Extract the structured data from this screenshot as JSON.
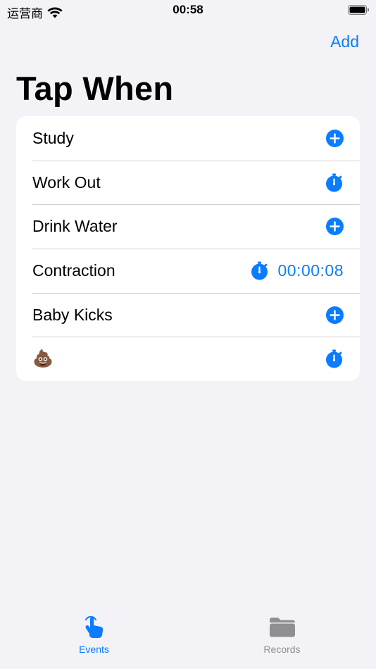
{
  "status_bar": {
    "carrier": "运营商",
    "time": "00:58"
  },
  "nav": {
    "add_label": "Add"
  },
  "title": "Tap When",
  "events": [
    {
      "name": "Study",
      "action": "add"
    },
    {
      "name": "Work Out",
      "action": "stopwatch"
    },
    {
      "name": "Drink Water",
      "action": "add"
    },
    {
      "name": "Contraction",
      "action": "stopwatch",
      "elapsed": "00:00:08"
    },
    {
      "name": "Baby Kicks",
      "action": "add"
    },
    {
      "name": "💩",
      "action": "stopwatch"
    }
  ],
  "tabs": [
    {
      "label": "Events",
      "icon": "hand-tap-icon",
      "active": true
    },
    {
      "label": "Records",
      "icon": "folder-icon",
      "active": false
    }
  ],
  "colors": {
    "accent": "#0a7cff",
    "background": "#f2f2f7",
    "inactive": "#8e8e93"
  }
}
